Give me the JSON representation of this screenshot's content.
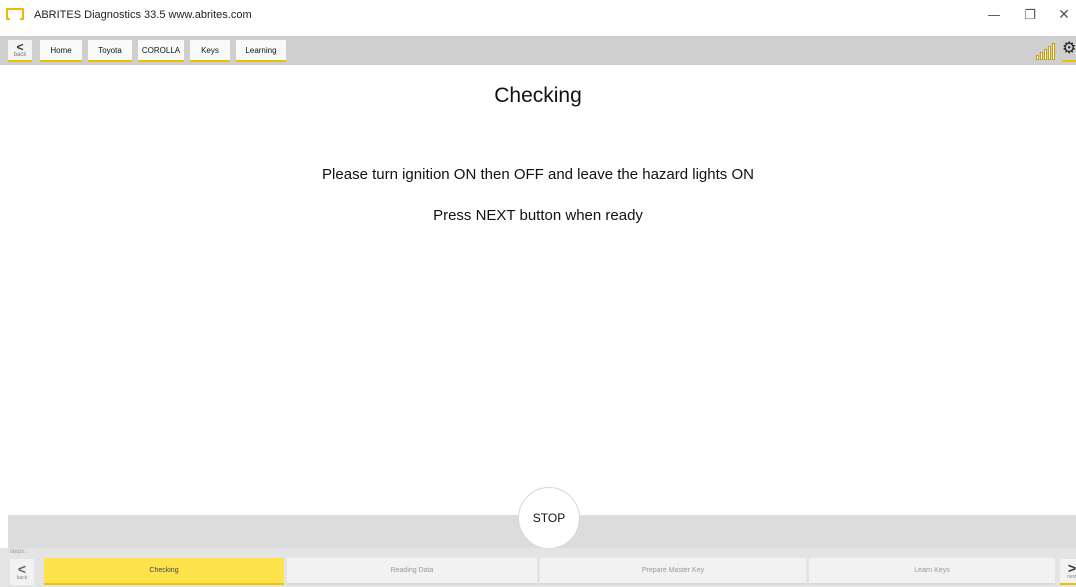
{
  "window": {
    "title": "ABRITES Diagnostics 33.5   www.abrites.com",
    "controls": {
      "minimize": "—",
      "restore": "❐",
      "close": "✕"
    }
  },
  "breadcrumb": {
    "back_label": "back",
    "back_glyph": "<",
    "items": [
      "Home",
      "Toyota",
      "COROLLA",
      "Keys",
      "Learning"
    ]
  },
  "toolbar": {
    "signal_icon": "signal-strength-icon",
    "settings_icon": "gear-icon",
    "gear_glyph": "⚙"
  },
  "main": {
    "title": "Checking",
    "instructions": [
      "Please turn ignition ON then OFF and leave the hazard lights ON",
      "Press NEXT button when ready"
    ]
  },
  "stop_button": {
    "label": "STOP"
  },
  "footer": {
    "steps_label": "steps:",
    "back_label": "back",
    "back_glyph": "<",
    "next_label": "next",
    "next_glyph": ">",
    "steps": [
      {
        "label": "Checking",
        "active": true
      },
      {
        "label": "Reading Data",
        "active": false
      },
      {
        "label": "Prepare Master Key",
        "active": false
      },
      {
        "label": "Learn Keys",
        "active": false
      }
    ]
  },
  "colors": {
    "accent": "#f2c500",
    "toolbar_bg": "#cfcfcf",
    "active_step": "#ffe34d"
  }
}
